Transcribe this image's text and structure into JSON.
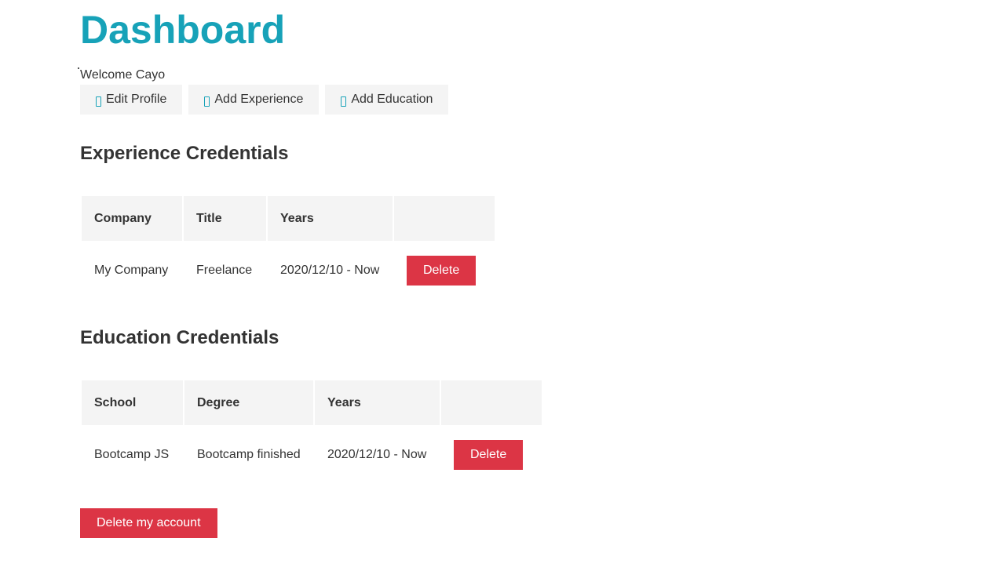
{
  "page": {
    "title": "Dashboard",
    "welcome": "Welcome Cayo"
  },
  "actions": [
    {
      "label": "Edit Profile",
      "icon": "user-circle-icon"
    },
    {
      "label": "Add Experience",
      "icon": "briefcase-icon"
    },
    {
      "label": "Add Education",
      "icon": "graduation-cap-icon"
    }
  ],
  "experience": {
    "heading": "Experience Credentials",
    "headers": [
      "Company",
      "Title",
      "Years",
      ""
    ],
    "rows": [
      {
        "company": "My Company",
        "title": "Freelance",
        "years": "2020/12/10 - Now",
        "delete_label": "Delete"
      }
    ]
  },
  "education": {
    "heading": "Education Credentials",
    "headers": [
      "School",
      "Degree",
      "Years",
      ""
    ],
    "rows": [
      {
        "school": "Bootcamp JS",
        "degree": "Bootcamp finished",
        "years": "2020/12/10 - Now",
        "delete_label": "Delete"
      }
    ]
  },
  "delete_account_label": "Delete my account",
  "colors": {
    "primary": "#17a2b8",
    "danger": "#dc3545",
    "light": "#f4f4f4",
    "text": "#333333"
  }
}
